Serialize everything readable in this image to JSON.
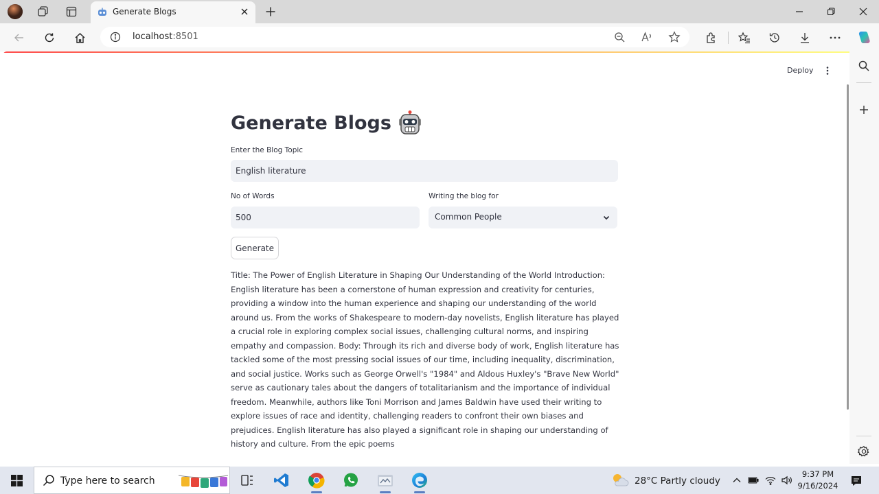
{
  "browser": {
    "tab_title": "Generate Blogs",
    "url_host": "localhost",
    "url_port": ":8501"
  },
  "streamlit": {
    "deploy_label": "Deploy"
  },
  "app": {
    "title": "Generate Blogs",
    "title_emoji": "robot-face",
    "topic_label": "Enter the Blog Topic",
    "topic_value": "English literature",
    "words_label": "No of Words",
    "words_value": "500",
    "audience_label": "Writing the blog for",
    "audience_value": "Common People",
    "generate_label": "Generate",
    "output": "Title: The Power of English Literature in Shaping Our Understanding of the World Introduction: English literature has been a cornerstone of human expression and creativity for centuries, providing a window into the human experience and shaping our understanding of the world around us. From the works of Shakespeare to modern-day novelists, English literature has played a crucial role in exploring complex social issues, challenging cultural norms, and inspiring empathy and compassion. Body: Through its rich and diverse body of work, English literature has tackled some of the most pressing social issues of our time, including inequality, discrimination, and social justice. Works such as George Orwell's \"1984\" and Aldous Huxley's \"Brave New World\" serve as cautionary tales about the dangers of totalitarianism and the importance of individual freedom. Meanwhile, authors like Toni Morrison and James Baldwin have used their writing to explore issues of race and identity, challenging readers to confront their own biases and prejudices. English literature has also played a significant role in shaping our understanding of history and culture. From the epic poems"
  },
  "taskbar": {
    "search_placeholder": "Type here to search",
    "weather_text": "28°C  Partly cloudy",
    "time": "9:37 PM",
    "date": "9/16/2024"
  },
  "colors": {
    "accent_red": "#ff4b4b",
    "input_bg": "#f0f2f6",
    "text": "#31333f",
    "taskbar_bg": "#e2e6ef"
  }
}
